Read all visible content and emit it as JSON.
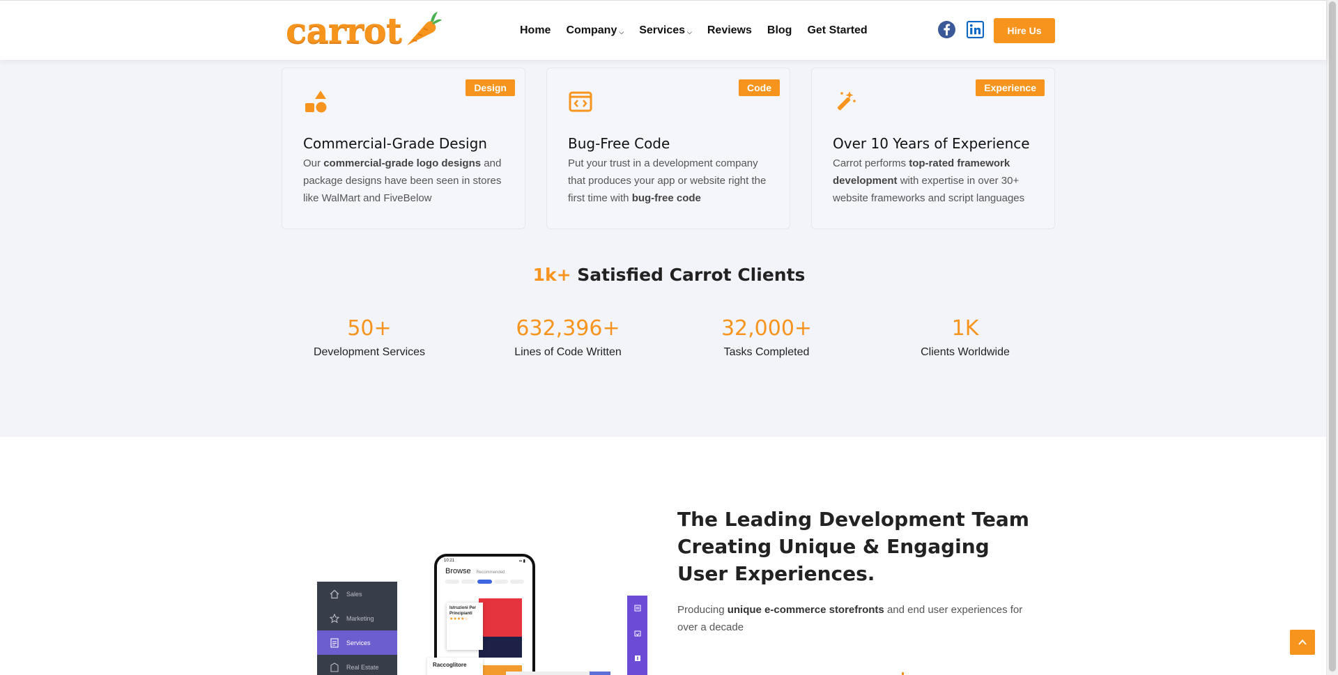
{
  "header": {
    "logo_text": "carrot",
    "nav": [
      {
        "label": "Home",
        "has_dropdown": false
      },
      {
        "label": "Company",
        "has_dropdown": true
      },
      {
        "label": "Services",
        "has_dropdown": true
      },
      {
        "label": "Reviews",
        "has_dropdown": false
      },
      {
        "label": "Blog",
        "has_dropdown": false
      },
      {
        "label": "Get Started",
        "has_dropdown": false
      }
    ],
    "social": [
      "facebook-icon",
      "linkedin-icon"
    ],
    "hire_label": "Hire Us"
  },
  "features": [
    {
      "badge": "Design",
      "icon": "shapes-icon",
      "title": "Commercial-Grade Design",
      "desc_pre": "Our ",
      "desc_bold": "commercial-grade logo designs",
      "desc_post": " and package designs have been seen in stores like WalMart and FiveBelow"
    },
    {
      "badge": "Code",
      "icon": "code-icon",
      "title": "Bug-Free Code",
      "desc_pre": "Put your trust in a development company that produces your app or website right the first time with ",
      "desc_bold": "bug-free code",
      "desc_post": ""
    },
    {
      "badge": "Experience",
      "icon": "magic-wand-icon",
      "title": "Over 10 Years of Experience",
      "desc_pre": "Carrot performs ",
      "desc_bold": "top-rated framework development",
      "desc_post": " with expertise in over 30+ website frameworks and script languages"
    }
  ],
  "clients": {
    "accent": "1k+",
    "title": " Satisfied Carrot Clients"
  },
  "stats": [
    {
      "num": "50+",
      "label": "Development Services"
    },
    {
      "num": "632,396+",
      "label": "Lines of Code Written"
    },
    {
      "num": "32,000+",
      "label": "Tasks Completed"
    },
    {
      "num": "1K",
      "label": "Clients Worldwide"
    }
  ],
  "lead": {
    "title": "The Leading Development Team Creating Unique & Engaging User Experiences.",
    "desc_pre": "Producing ",
    "desc_bold": "unique e-commerce storefronts",
    "desc_post": " and end user experiences for over a decade"
  },
  "mockup": {
    "sidebar": [
      "Sales",
      "Marketing",
      "Services",
      "Real Estate"
    ],
    "active_item": "Services",
    "phone_time": "10:21",
    "phone_heading": "Browse",
    "phone_sub": "Recommended",
    "phone_card": "Istruzioni Per Principianti",
    "label": "Raccoglitore"
  },
  "colors": {
    "accent": "#f7941d",
    "section_bg": "#f3f4fa",
    "purple": "#6c5ecf"
  }
}
